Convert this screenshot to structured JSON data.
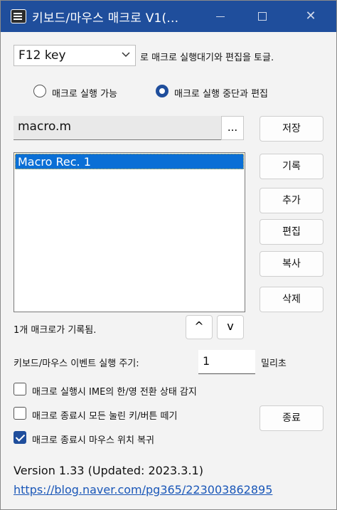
{
  "window": {
    "title": "키보드/마우스 매크로 V1(...",
    "controls": {
      "close": "✕"
    }
  },
  "hotkey": {
    "selected": "F12 key",
    "hint": "로 매크로 실행대기와 편집을 토글."
  },
  "mode": {
    "option_run": "매크로 실행 가능",
    "option_edit": "매크로 실행 중단과 편집",
    "selected": "option_edit"
  },
  "file": {
    "name": "macro.m",
    "browse_label": "..."
  },
  "buttons": {
    "save": "저장",
    "record": "기록",
    "add": "추가",
    "edit": "편집",
    "copy": "복사",
    "delete": "삭제",
    "exit": "종료",
    "move_up": "^",
    "move_down": "v"
  },
  "macro_list": {
    "items": [
      "Macro Rec. 1"
    ],
    "selected_index": 0
  },
  "status": {
    "count_text": "1개 매크로가 기록됨."
  },
  "interval": {
    "label": "키보드/마우스 이벤트 실행 주기:",
    "value": "1",
    "unit": "밀리초"
  },
  "options": [
    {
      "label": "매크로 실행시 IME의 한/영 전환 상태 감지",
      "checked": false
    },
    {
      "label": "매크로 종료시 모든 눌린 키/버튼 떼기",
      "checked": false
    },
    {
      "label": "매크로 종료시 마우스 위치 복귀",
      "checked": true
    }
  ],
  "footer": {
    "version": "Version 1.33 (Updated: 2023.3.1)",
    "link": "https://blog.naver.com/pg365/223003862895"
  },
  "colors": {
    "titlebar": "#1f4e9c",
    "selection": "#0a6fd6",
    "link": "#1a57b8"
  }
}
